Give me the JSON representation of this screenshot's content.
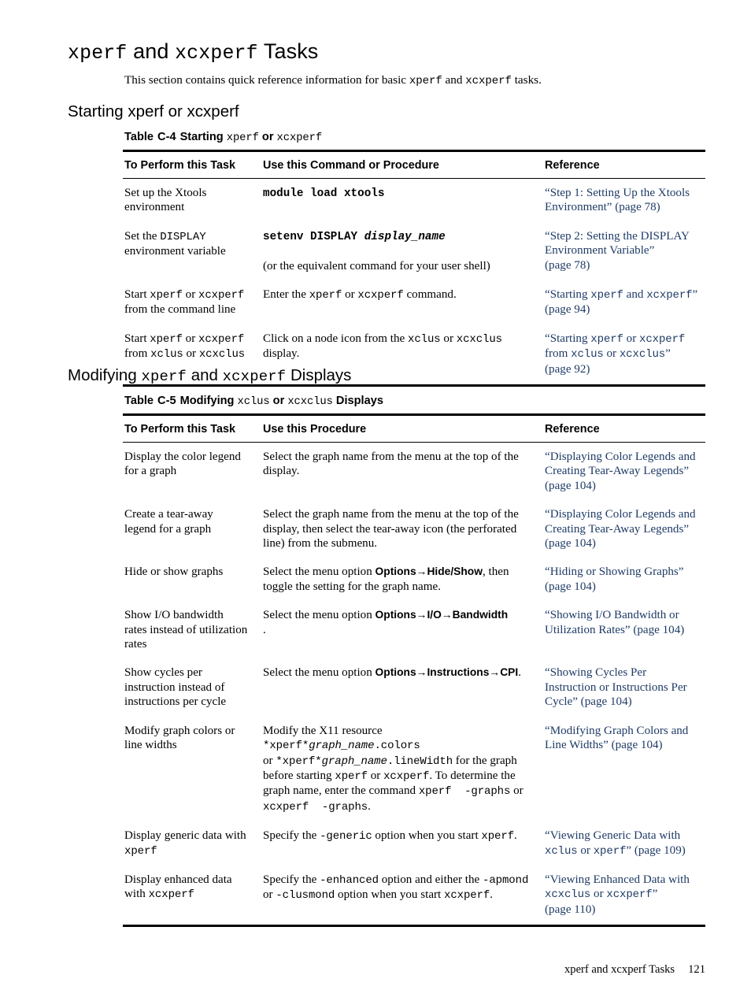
{
  "page": {
    "title_parts": [
      {
        "text": "xperf",
        "style": "mono"
      },
      {
        "text": " and ",
        "style": "plain"
      },
      {
        "text": "xcxperf",
        "style": "mono"
      },
      {
        "text": " Tasks",
        "style": "plain"
      }
    ],
    "title_plain": "xperf and xcxperf Tasks",
    "intro": "This section contains quick reference information for basic xperf and xcxperf tasks.",
    "footer_text": "xperf and xcxperf Tasks",
    "footer_page": "121"
  },
  "sections": [
    {
      "heading": "Starting xperf or xcxperf",
      "table": {
        "caption_label": "Table",
        "caption_number": "C-4",
        "caption_title": "Starting xperf or xcxperf",
        "headers": [
          "To Perform this Task",
          "Use this Command or Procedure",
          "Reference"
        ],
        "rows": [
          {
            "task": "Set up the Xtools environment",
            "procedure": "module load xtools",
            "procedure_note": "",
            "reference": "“Step 1: Setting Up the Xtools Environment” (page 78)",
            "reference_lines": [
              "“Step 1: Setting Up the Xtools",
              "Environment” (page 78)"
            ]
          },
          {
            "task": "Set the DISPLAY environment variable",
            "procedure": "setenv DISPLAY display_name",
            "procedure_note": "(or the equivalent command for your user shell)",
            "reference": "“Step 2: Setting the DISPLAY Environment Variable” (page 78)",
            "reference_lines": [
              "“Step 2: Setting the DISPLAY",
              "Environment Variable”",
              "(page 78)"
            ]
          },
          {
            "task": "Start xperf or xcxperf from the command line",
            "procedure": "Enter the xperf or xcxperf command.",
            "procedure_note": "",
            "reference": "“Starting xperf and xcxperf” (page 94)",
            "reference_lines": [
              "“Starting xperf and xcxperf”",
              "(page 94)"
            ]
          },
          {
            "task": "Start xperf or xcxperf from xclus or xcxclus",
            "procedure": "Click on a node icon from the xclus or xcxclus display.",
            "procedure_note": "",
            "reference": "“Starting xperf or xcxperf from xclus or xcxclus” (page 92)",
            "reference_lines": [
              "“Starting xperf or xcxperf",
              "from xclus or xcxclus”",
              "(page 92)"
            ]
          }
        ]
      }
    },
    {
      "heading": "Modifying xperf and xcxperf Displays",
      "table": {
        "caption_label": "Table",
        "caption_number": "C-5",
        "caption_title": "Modifying xclus or xcxclus Displays",
        "headers": [
          "To Perform this Task",
          "Use this Procedure",
          "Reference"
        ],
        "rows": [
          {
            "task": "Display the color legend for a graph",
            "procedure": "Select the graph name from the menu at the top of the display.",
            "reference": "“Displaying Color Legends and Creating Tear-Away Legends” (page 104)",
            "reference_lines": [
              "“Displaying Color Legends and",
              "Creating Tear-Away Legends”",
              "(page 104)"
            ]
          },
          {
            "task": "Create a tear-away legend for a graph",
            "procedure": "Select the graph name from the menu at the top of the display, then select the tear-away icon (the perforated line) from the submenu.",
            "reference": "“Displaying Color Legends and Creating Tear-Away Legends” (page 104)",
            "reference_lines": [
              "“Displaying Color Legends and",
              "Creating Tear-Away Legends”",
              "(page 104)"
            ]
          },
          {
            "task": "Hide or show graphs",
            "procedure": "Select the menu option Options→Hide/Show, then toggle the setting for the graph name.",
            "menu_path": "Options→Hide/Show",
            "reference": "“Hiding or Showing Graphs” (page 104)",
            "reference_lines": [
              "“Hiding or Showing Graphs”",
              "(page 104)"
            ]
          },
          {
            "task": "Show I/O bandwidth rates instead of utilization rates",
            "procedure": "Select the menu option Options→I/O→Bandwidth .",
            "menu_path": "Options→I/O→Bandwidth",
            "reference": "“Showing I/O Bandwidth or Utilization Rates” (page 104)",
            "reference_lines": [
              "“Showing I/O Bandwidth or",
              "Utilization Rates” (page 104)"
            ]
          },
          {
            "task": "Show cycles per instruction instead of instructions per cycle",
            "procedure": "Select the menu option Options→Instructions→CPI.",
            "menu_path": "Options→Instructions→CPI",
            "reference": "“Showing Cycles Per Instruction or Instructions Per Cycle” (page 104)",
            "reference_lines": [
              "“Showing Cycles Per",
              "Instruction or Instructions Per",
              "Cycle” (page 104)"
            ]
          },
          {
            "task": "Modify graph colors or line widths",
            "procedure": "Modify the X11 resource *xperf*graph_name.colors or *xperf*graph_name.lineWidth for the graph before starting xperf or xcxperf. To determine the graph name, enter the command xperf -graphs or xcxperf -graphs.",
            "reference": "“Modifying Graph Colors and Line Widths” (page 104)",
            "reference_lines": [
              "“Modifying Graph Colors and",
              "Line Widths” (page 104)"
            ]
          },
          {
            "task": "Display generic data with xperf",
            "procedure": "Specify the -generic option when you start xperf.",
            "reference": "“Viewing Generic Data with xclus or xperf” (page 109)",
            "reference_lines": [
              "“Viewing Generic Data with",
              "xclus or xperf” (page 109)"
            ]
          },
          {
            "task": "Display enhanced data with xcxperf",
            "procedure": "Specify the -enhanced option and either the -apmond or -clusmond option when you start xcxperf.",
            "reference": "“Viewing Enhanced Data with xcxclus or xcxperf” (page 110)",
            "reference_lines": [
              "“Viewing Enhanced Data with",
              "xcxclus or xcxperf”",
              "(page 110)"
            ]
          }
        ]
      }
    }
  ],
  "colors": {
    "link": "#1f3b66",
    "text": "#000000",
    "rule": "#000000",
    "background": "#ffffff"
  }
}
